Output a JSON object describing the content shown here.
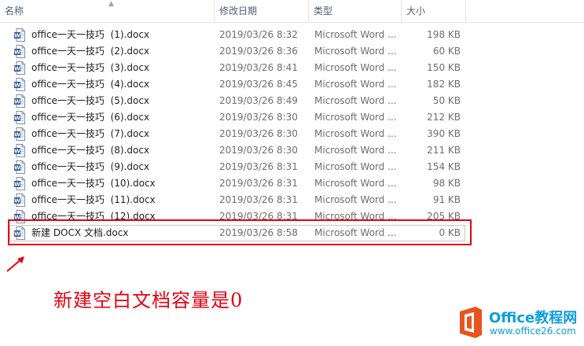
{
  "columns": {
    "name": "名称",
    "date": "修改日期",
    "type": "类型",
    "size": "大小"
  },
  "files": [
    {
      "name": "office一天一技巧  (1).docx",
      "date": "2019/03/26 8:32",
      "type": "Microsoft Word ...",
      "size": "198 KB"
    },
    {
      "name": "office一天一技巧  (2).docx",
      "date": "2019/03/26 8:36",
      "type": "Microsoft Word ...",
      "size": "60 KB"
    },
    {
      "name": "office一天一技巧  (3).docx",
      "date": "2019/03/26 8:41",
      "type": "Microsoft Word ...",
      "size": "150 KB"
    },
    {
      "name": "office一天一技巧  (4).docx",
      "date": "2019/03/26 8:45",
      "type": "Microsoft Word ...",
      "size": "182 KB"
    },
    {
      "name": "office一天一技巧  (5).docx",
      "date": "2019/03/26 8:49",
      "type": "Microsoft Word ...",
      "size": "50 KB"
    },
    {
      "name": "office一天一技巧  (6).docx",
      "date": "2019/03/26 8:30",
      "type": "Microsoft Word ...",
      "size": "212 KB"
    },
    {
      "name": "office一天一技巧  (7).docx",
      "date": "2019/03/26 8:30",
      "type": "Microsoft Word ...",
      "size": "390 KB"
    },
    {
      "name": "office一天一技巧  (8).docx",
      "date": "2019/03/26 8:30",
      "type": "Microsoft Word ...",
      "size": "211 KB"
    },
    {
      "name": "office一天一技巧  (9).docx",
      "date": "2019/03/26 8:31",
      "type": "Microsoft Word ...",
      "size": "154 KB"
    },
    {
      "name": "office一天一技巧  (10).docx",
      "date": "2019/03/26 8:31",
      "type": "Microsoft Word ...",
      "size": "98 KB"
    },
    {
      "name": "office一天一技巧  (11).docx",
      "date": "2019/03/26 8:31",
      "type": "Microsoft Word ...",
      "size": "91 KB"
    },
    {
      "name": "office一天一技巧  (12).docx",
      "date": "2019/03/26 8:31",
      "type": "Microsoft Word ...",
      "size": "205 KB"
    },
    {
      "name": "新建 DOCX 文档.docx",
      "date": "2019/03/26 8:58",
      "type": "Microsoft Word ...",
      "size": "0 KB"
    }
  ],
  "annotation": "新建空白文档容量是0",
  "logo": {
    "title": "Office教程网",
    "subtitle": "www.office26.com"
  },
  "colors": {
    "annotation": "#e60012",
    "header_text": "#4c607a",
    "logo_orange": "#e8531f",
    "logo_blue": "#0b9de0",
    "word_icon": "#2b5797"
  }
}
